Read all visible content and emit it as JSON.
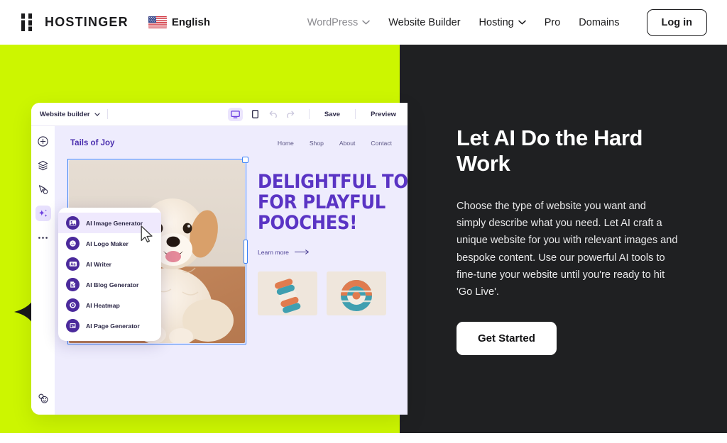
{
  "colors": {
    "lime": "#ccf600",
    "dark": "#1f2022",
    "purple": "#5a34c4",
    "badge_purple": "#4b2a9c",
    "selection_blue": "#3b82f6",
    "canvas_lavender": "#eeecfd"
  },
  "header": {
    "brand": {
      "name": "HOSTINGER",
      "icon": "hostinger-h-logo"
    },
    "language": {
      "label": "English",
      "icon": "us-flag-icon"
    },
    "nav": [
      {
        "label": "WordPress",
        "has_dropdown": true,
        "muted": true
      },
      {
        "label": "Website Builder",
        "has_dropdown": false,
        "muted": false
      },
      {
        "label": "Hosting",
        "has_dropdown": true,
        "muted": false
      },
      {
        "label": "Pro",
        "has_dropdown": false,
        "muted": false
      },
      {
        "label": "Domains",
        "has_dropdown": false,
        "muted": false
      }
    ],
    "login_label": "Log in"
  },
  "hero": {
    "title": "Let AI Do the Hard Work",
    "body": "Choose the type of website you want and simply describe what you need. Let AI craft a unique website for you with relevant images and bespoke content. Use our powerful AI tools to fine-tune your website until you're ready to hit 'Go Live'.",
    "cta_label": "Get Started"
  },
  "builder": {
    "topbar": {
      "project_select": "Website builder",
      "save_label": "Save",
      "preview_label": "Preview",
      "view_desktop_icon": "desktop-monitor-icon",
      "view_mobile_icon": "mobile-phone-icon",
      "undo_icon": "undo-arrow-icon",
      "redo_icon": "redo-arrow-icon"
    },
    "rail": [
      {
        "name": "add-element",
        "icon": "plus-circle-icon",
        "active": false
      },
      {
        "name": "layers",
        "icon": "layers-icon",
        "active": false
      },
      {
        "name": "pointer",
        "icon": "cursor-pointer-icon",
        "active": false
      },
      {
        "name": "ai-tools",
        "icon": "sparkle-ai-icon",
        "active": true
      },
      {
        "name": "more",
        "icon": "more-dots-icon",
        "active": false
      },
      {
        "name": "help",
        "icon": "help-smiley-icon",
        "active": false
      }
    ],
    "site": {
      "logo": "Tails of Joy",
      "nav": [
        "Home",
        "Shop",
        "About",
        "Contact"
      ],
      "headline_lines": [
        "DELIGHTFUL TOYS",
        "FOR PLAYFUL",
        "POOCHES!"
      ],
      "learn_more": "Learn more",
      "hero_image_alt": "happy cream cockapoo puppy sitting on couch with grey plush toy",
      "thumbnails": [
        {
          "alt": "twisted rope dog toy in teal orange and cream"
        },
        {
          "alt": "round braided ball dog toy in teal orange and cream"
        }
      ]
    },
    "ai_menu": {
      "items": [
        {
          "label": "AI Image Generator",
          "icon": "ai-image-icon",
          "selected": true
        },
        {
          "label": "AI Logo Maker",
          "icon": "ai-logo-icon",
          "selected": false
        },
        {
          "label": "AI Writer",
          "icon": "ai-writer-aa-icon",
          "selected": false
        },
        {
          "label": "AI Blog Generator",
          "icon": "ai-blog-icon",
          "selected": false
        },
        {
          "label": "AI Heatmap",
          "icon": "ai-heatmap-icon",
          "selected": false
        },
        {
          "label": "AI Page Generator",
          "icon": "ai-page-icon",
          "selected": false
        }
      ]
    }
  },
  "decorations": {
    "stars": [
      {
        "name": "star-top",
        "size": 40
      },
      {
        "name": "star-left",
        "size": 66
      },
      {
        "name": "star-bottom",
        "size": 36
      }
    ]
  }
}
